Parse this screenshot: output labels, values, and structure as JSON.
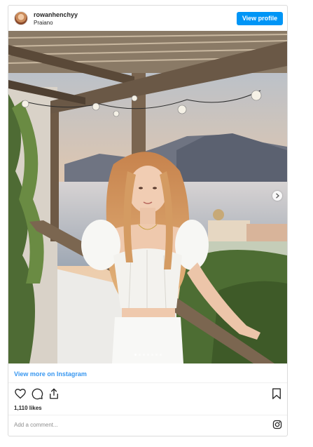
{
  "post": {
    "username": "rowanhenchyy",
    "location": "Praiano",
    "view_profile_label": "View profile",
    "view_more_label": "View more on Instagram",
    "likes_text": "1,110 likes",
    "comment_placeholder": "Add a comment...",
    "carousel": {
      "slide_count": 7,
      "active_slide": 1
    }
  },
  "colors": {
    "accent": "#0095f6",
    "link": "#3897f0",
    "border": "#dbdbdb"
  },
  "icons": [
    "heart-icon",
    "comment-icon",
    "share-icon",
    "bookmark-icon",
    "instagram-logo-icon",
    "chevron-right-icon"
  ]
}
